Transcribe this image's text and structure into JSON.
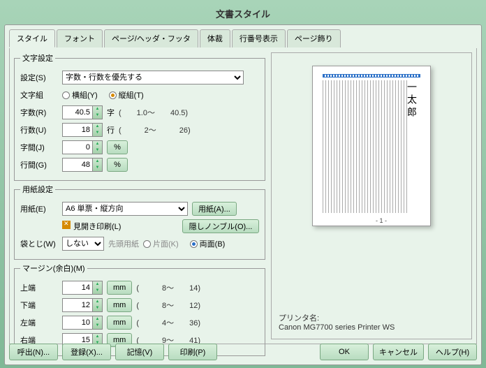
{
  "window": {
    "title": "文書スタイル"
  },
  "tabs": [
    "スタイル",
    "フォント",
    "ページ/ヘッダ・フッタ",
    "体裁",
    "行番号表示",
    "ページ飾り"
  ],
  "char_settings": {
    "legend": "文字設定",
    "setting_lbl": "設定(S)",
    "setting_val": "字数・行数を優先する",
    "moji_lbl": "文字組",
    "yoko": "横組(Y)",
    "tate": "縦組(T)",
    "jisu_lbl": "字数(R)",
    "jisu_val": "40.5",
    "jisu_unit": "字",
    "jisu_range": "(　　1.0～　　40.5)",
    "gyosu_lbl": "行数(U)",
    "gyosu_val": "18",
    "gyosu_unit": "行",
    "gyosu_range": "(　　　2～　　　26)",
    "jikan_lbl": "字間(J)",
    "jikan_val": "0",
    "pct": "%",
    "gyokan_lbl": "行間(G)",
    "gyokan_val": "48"
  },
  "paper_settings": {
    "legend": "用紙設定",
    "paper_lbl": "用紙(E)",
    "paper_val": "A6 単票・縦方向",
    "paper_btn": "用紙(A)...",
    "spread_chk": "見開き印刷(L)",
    "hidenumber_btn": "隠しノンブル(O)...",
    "fukuro_lbl": "袋とじ(W)",
    "fukuro_val": "しない",
    "sentou": "先頭用紙",
    "katamen": "片面(K)",
    "ryomen": "両面(B)"
  },
  "margin": {
    "legend": "マージン(余白)(M)",
    "unit": "mm",
    "top_lbl": "上端",
    "top_val": "14",
    "top_range": "(　　　8～　　14)",
    "bot_lbl": "下端",
    "bot_val": "12",
    "bot_range": "(　　　8～　　12)",
    "left_lbl": "左端",
    "left_val": "10",
    "left_range": "(　　　4～　　36)",
    "right_lbl": "右端",
    "right_val": "15",
    "right_range": "(　　　9～　　41)"
  },
  "preview": {
    "text": "一太郎",
    "pnum": "- 1 -",
    "printer_lbl": "プリンタ名:",
    "printer_val": "Canon MG7700 series Printer WS"
  },
  "buttons": {
    "recall": "呼出(N)...",
    "register": "登録(X)...",
    "memory": "記憶(V)",
    "print": "印刷(P)",
    "ok": "OK",
    "cancel": "キャンセル",
    "help": "ヘルプ(H)"
  }
}
